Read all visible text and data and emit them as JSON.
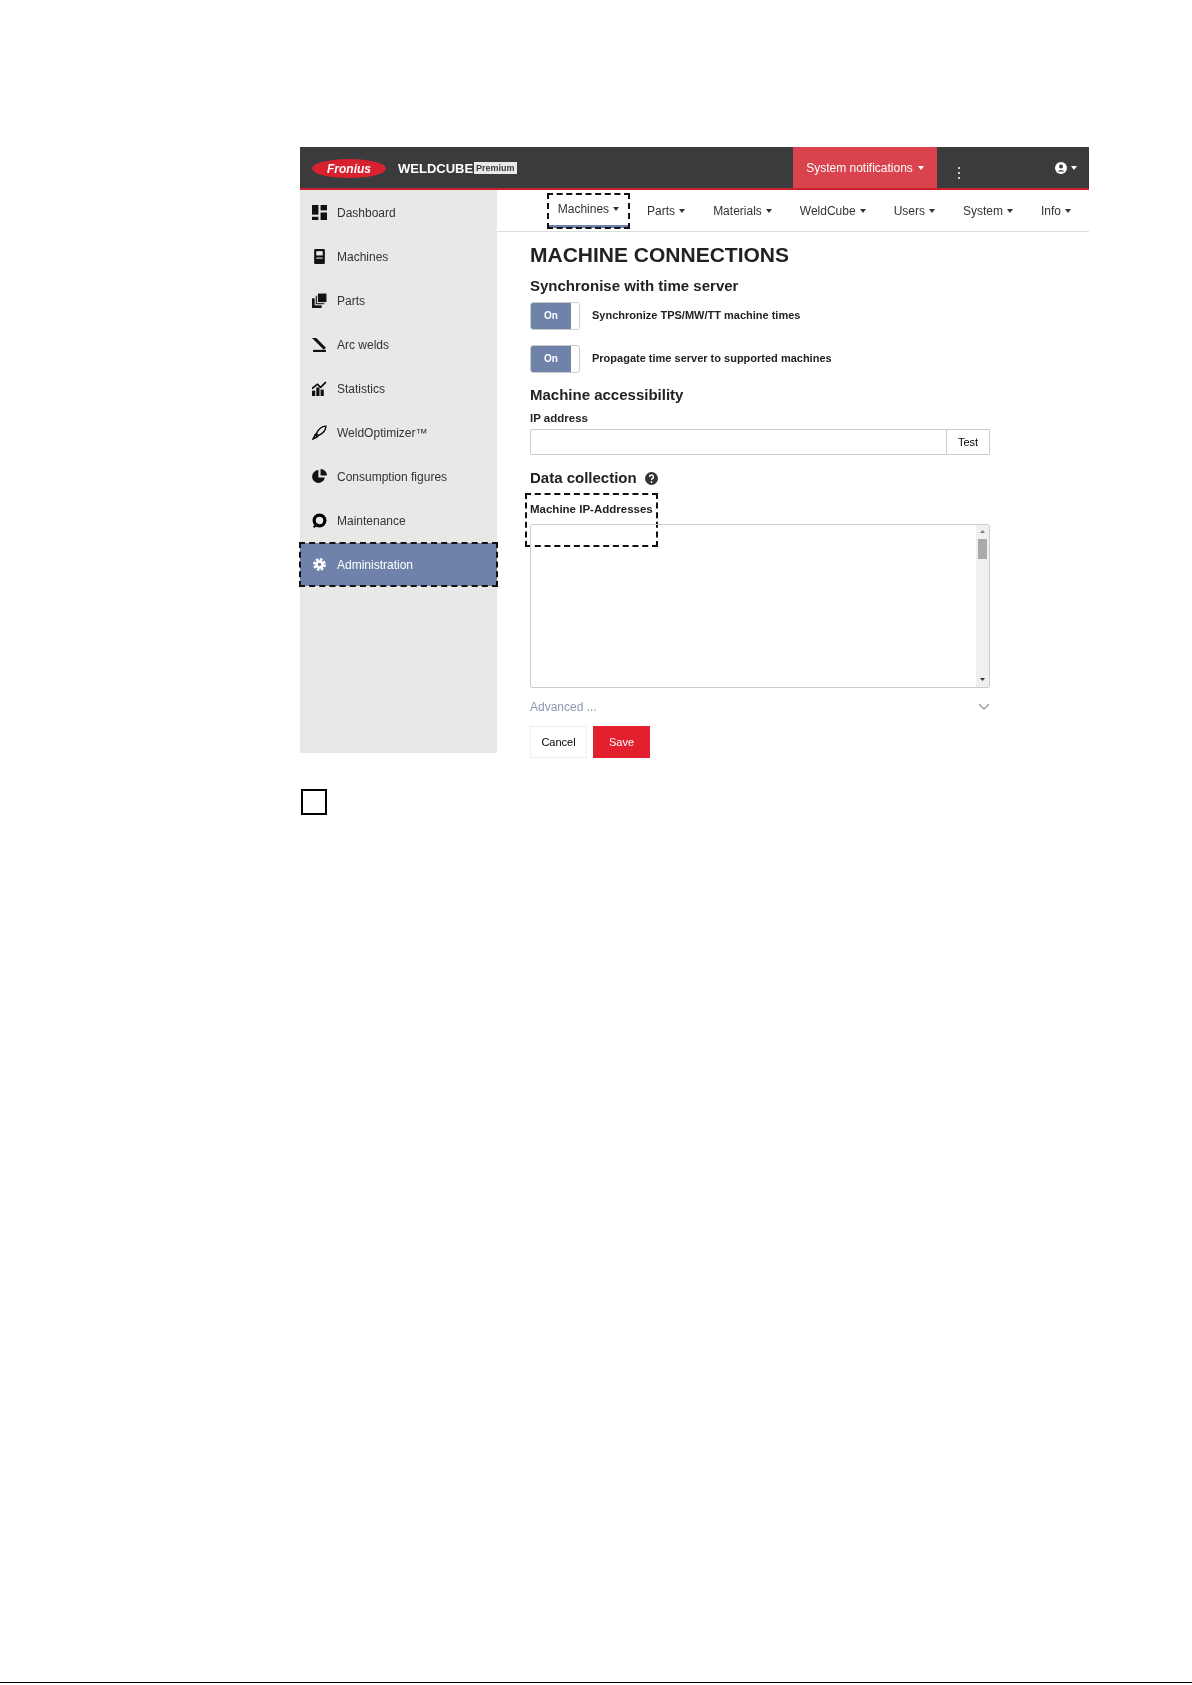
{
  "header": {
    "logo": "Fronius",
    "product": "WELDCUBE",
    "edition": "Premium",
    "notifications": "System notifications"
  },
  "sidebar": {
    "items": [
      {
        "label": "Dashboard",
        "selected": false,
        "highlighted": false
      },
      {
        "label": "Machines",
        "selected": false,
        "highlighted": false
      },
      {
        "label": "Parts",
        "selected": false,
        "highlighted": false
      },
      {
        "label": "Arc welds",
        "selected": false,
        "highlighted": false
      },
      {
        "label": "Statistics",
        "selected": false,
        "highlighted": false
      },
      {
        "label": "WeldOptimizer™",
        "selected": false,
        "highlighted": false
      },
      {
        "label": "Consumption figures",
        "selected": false,
        "highlighted": false
      },
      {
        "label": "Maintenance",
        "selected": false,
        "highlighted": false
      },
      {
        "label": "Administration",
        "selected": true,
        "highlighted": true
      }
    ]
  },
  "nav": {
    "tabs": [
      {
        "label": "Machines",
        "selected": true,
        "highlighted": true
      },
      {
        "label": "Parts",
        "selected": false,
        "highlighted": false
      },
      {
        "label": "Materials",
        "selected": false,
        "highlighted": false
      },
      {
        "label": "WeldCube",
        "selected": false,
        "highlighted": false
      },
      {
        "label": "Users",
        "selected": false,
        "highlighted": false
      },
      {
        "label": "System",
        "selected": false,
        "highlighted": false
      },
      {
        "label": "Info",
        "selected": false,
        "highlighted": false
      }
    ]
  },
  "page": {
    "title": "MACHINE CONNECTIONS",
    "sync": {
      "heading": "Synchronise with time server",
      "toggles": [
        {
          "state_text": "On",
          "on": true,
          "label": "Synchronize TPS/MW/TT machine times"
        },
        {
          "state_text": "On",
          "on": true,
          "label": "Propagate time server to supported machines"
        }
      ]
    },
    "accessibility": {
      "heading": "Machine accessibility",
      "field_label": "IP address",
      "button": "Test"
    },
    "data_collection": {
      "heading": "Data collection",
      "field_label": "Machine IP-Addresses",
      "highlighted": true
    },
    "advanced": "Advanced ...",
    "buttons": [
      "Cancel",
      "Save"
    ]
  },
  "document": {
    "checkbox": {
      "checked": false
    }
  }
}
